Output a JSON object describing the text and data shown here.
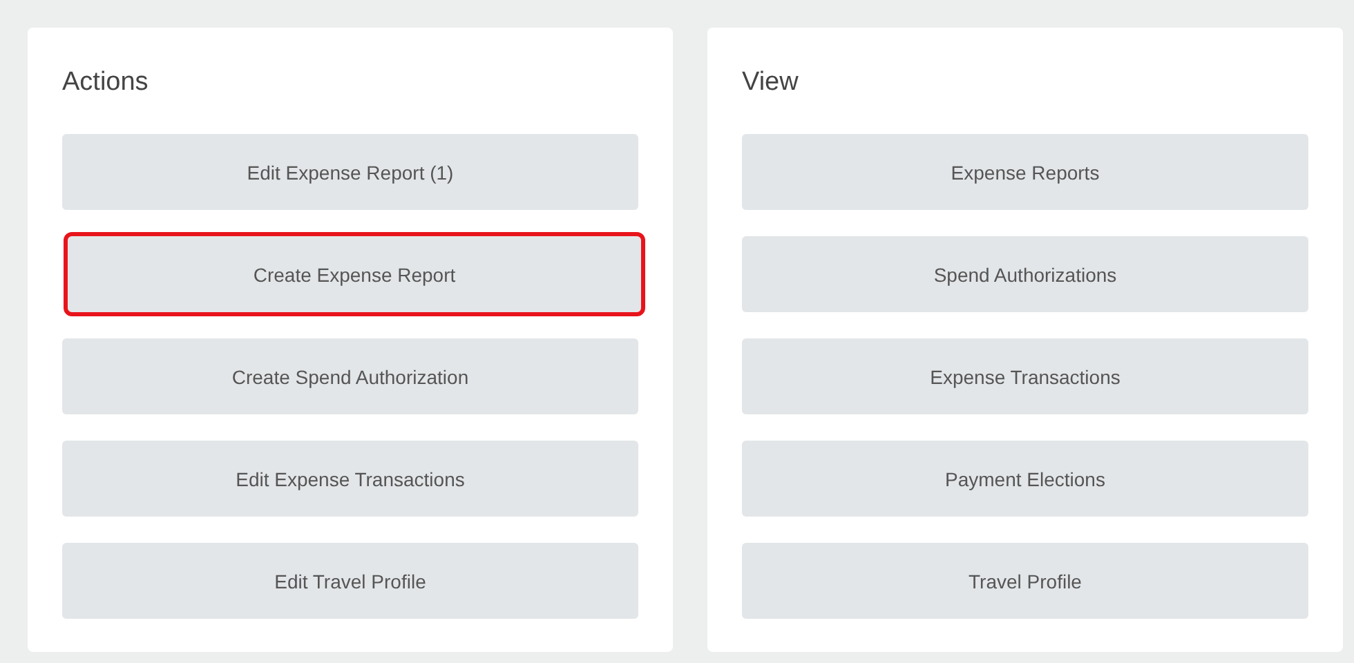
{
  "panels": [
    {
      "title": "Actions",
      "buttons": [
        {
          "label": "Edit Expense Report (1)",
          "highlighted": false
        },
        {
          "label": "Create Expense Report",
          "highlighted": true
        },
        {
          "label": "Create Spend Authorization",
          "highlighted": false
        },
        {
          "label": "Edit Expense Transactions",
          "highlighted": false
        },
        {
          "label": "Edit Travel Profile",
          "highlighted": false
        }
      ]
    },
    {
      "title": "View",
      "buttons": [
        {
          "label": "Expense Reports",
          "highlighted": false
        },
        {
          "label": "Spend Authorizations",
          "highlighted": false
        },
        {
          "label": "Expense Transactions",
          "highlighted": false
        },
        {
          "label": "Payment Elections",
          "highlighted": false
        },
        {
          "label": "Travel Profile",
          "highlighted": false
        }
      ]
    }
  ]
}
